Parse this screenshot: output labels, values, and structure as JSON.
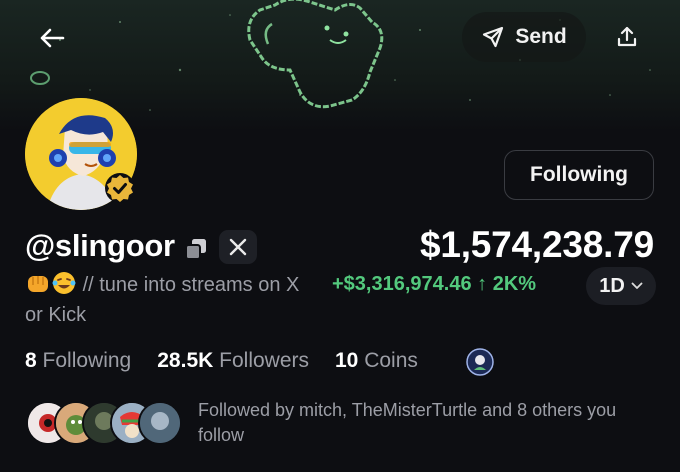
{
  "header": {
    "back_icon": "arrow-left-icon",
    "send_label": "Send",
    "send_icon": "paper-plane-icon",
    "share_icon": "share-upload-icon"
  },
  "profile": {
    "follow_button_label": "Following",
    "handle": "@slingoor",
    "bio_text": "// tune into streams on X or Kick",
    "bio_emojis": [
      "fist-icon",
      "laughing-crying-icon"
    ],
    "verified_icon": "verified-badge-icon",
    "social_icon": "x-logo-icon"
  },
  "balance": {
    "value": "$1,574,238.79",
    "change": "+$3,316,974.46 ↑ 2K%",
    "period": "1D"
  },
  "stats": {
    "following_count": "8",
    "following_label": "Following",
    "followers_count": "28.5K",
    "followers_label": "Followers",
    "coins_count": "10",
    "coins_label": "Coins"
  },
  "followed_by": {
    "text": "Followed by mitch, TheMisterTurtle and 8 others you follow"
  },
  "colors": {
    "background": "#0d0e12",
    "positive": "#53c97d",
    "muted_text": "#9c9ea6",
    "avatar_bg": "#f3cc2e"
  }
}
